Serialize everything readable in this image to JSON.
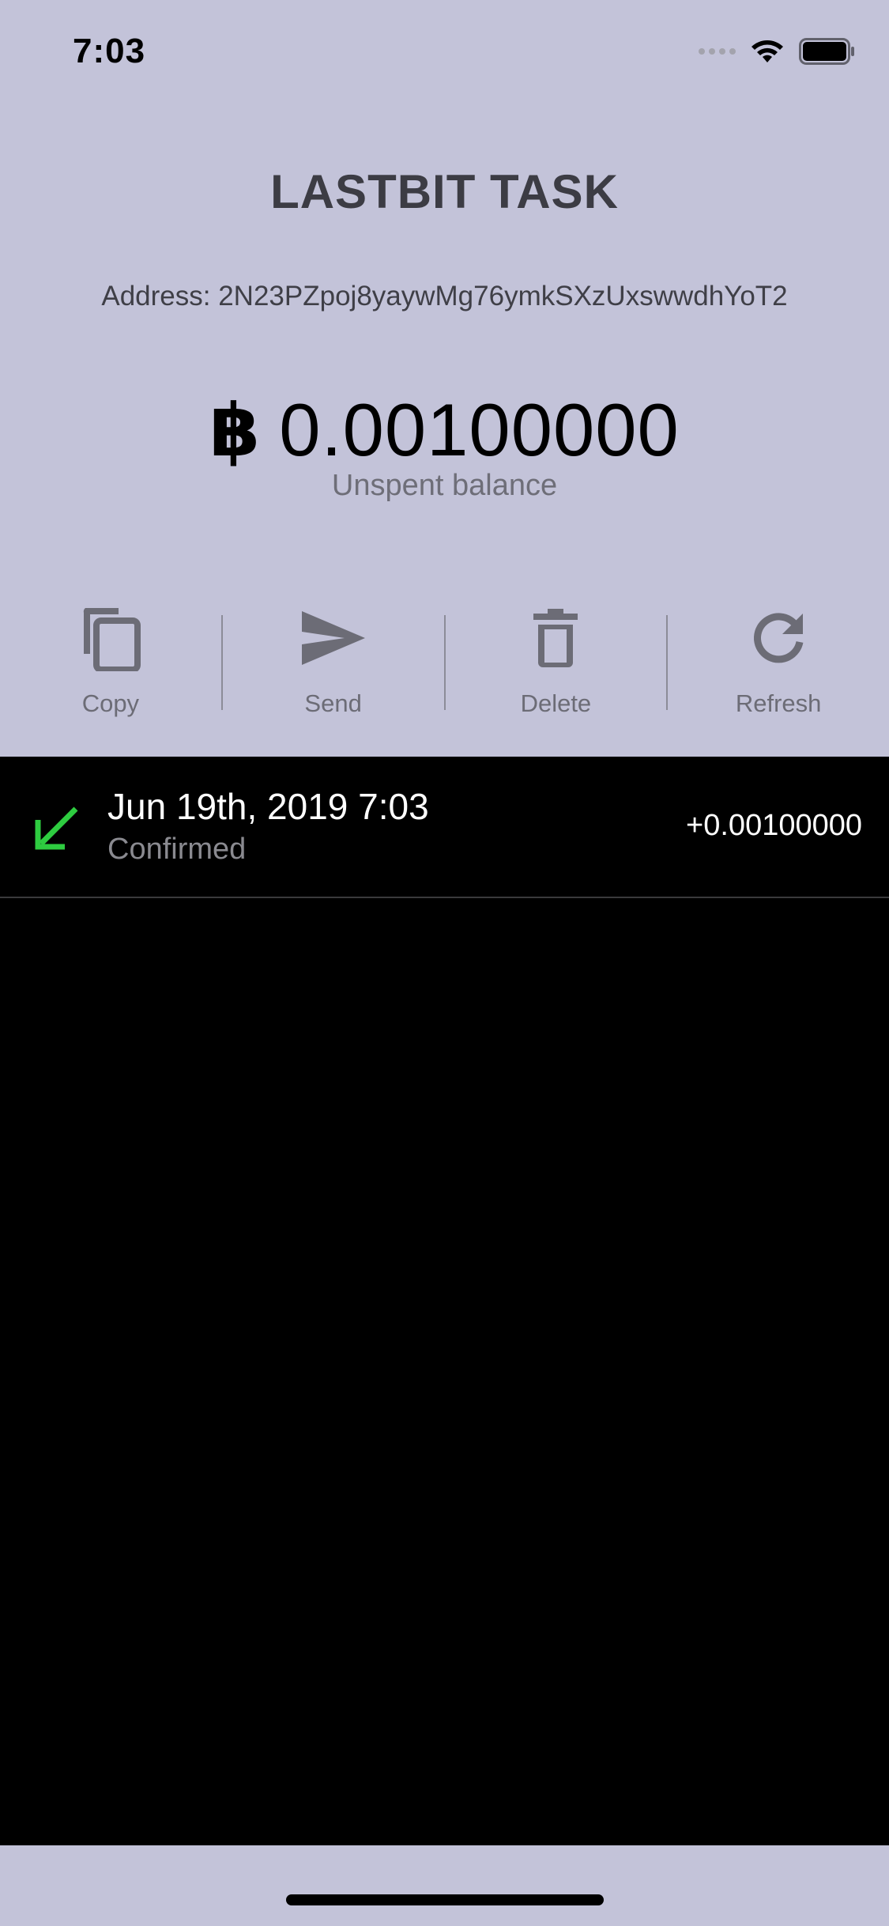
{
  "status_bar": {
    "time": "7:03",
    "icons": [
      "signal-icon",
      "wifi-icon",
      "battery-icon"
    ]
  },
  "header": {
    "title": "LASTBIT TASK",
    "address": "Address: 2N23PZpoj8yaywMg76ymkSXzUxswwdhYoT2"
  },
  "balance": {
    "symbol": "฿",
    "value": "0.00100000",
    "label": "Unspent balance"
  },
  "actions": [
    {
      "label": "Copy",
      "icon": "copy-icon"
    },
    {
      "label": "Send",
      "icon": "send-icon"
    },
    {
      "label": "Delete",
      "icon": "trash-icon"
    },
    {
      "label": "Refresh",
      "icon": "refresh-icon"
    }
  ],
  "transactions": [
    {
      "date": "Jun 19th, 2019 7:03",
      "status": "Confirmed",
      "amount": "+0.00100000",
      "icon": "incoming-arrow-icon"
    }
  ],
  "colors": {
    "panel_background": "#c3c3d9",
    "list_background": "#000000",
    "incoming_green": "#2ecc40",
    "icon_gray": "#6c6c76"
  }
}
